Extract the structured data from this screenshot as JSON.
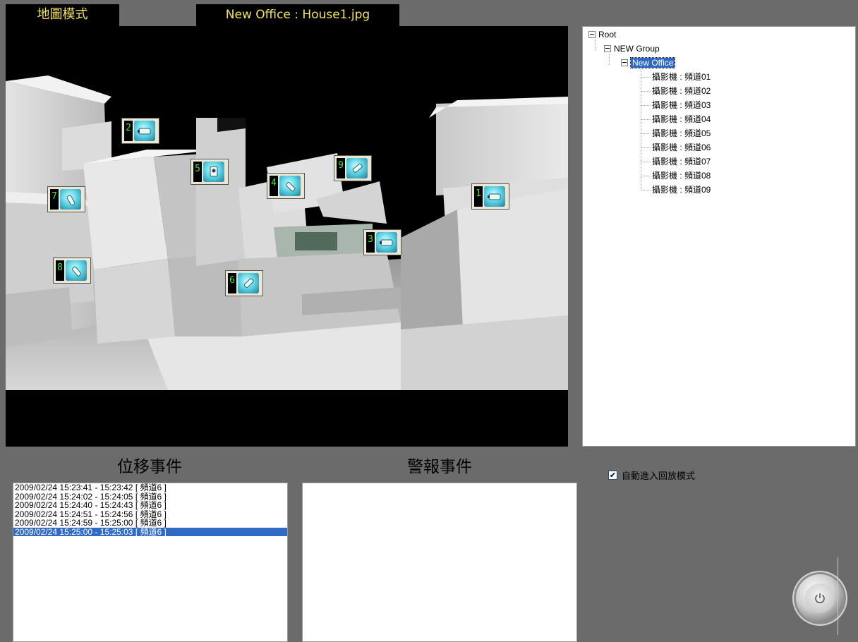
{
  "header": {
    "mode_tab": "地圖模式",
    "file_title": "New Office : House1.jpg"
  },
  "map": {
    "cameras": [
      {
        "num": "1",
        "icon": "dome-camera-icon"
      },
      {
        "num": "2",
        "icon": "dome-camera-icon"
      },
      {
        "num": "3",
        "icon": "dome-camera-icon"
      },
      {
        "num": "4",
        "icon": "bullet-camera-icon"
      },
      {
        "num": "5",
        "icon": "camera-front-icon"
      },
      {
        "num": "6",
        "icon": "bullet-camera-icon"
      },
      {
        "num": "7",
        "icon": "bullet-camera-icon"
      },
      {
        "num": "8",
        "icon": "bullet-camera-icon"
      },
      {
        "num": "9",
        "icon": "bullet-camera-icon"
      }
    ]
  },
  "tree": {
    "root": "Root",
    "group": "NEW Group",
    "office": "New Office",
    "channels": [
      "攝影機 : 頻道01",
      "攝影機 : 頻道02",
      "攝影機 : 頻道03",
      "攝影機 : 頻道04",
      "攝影機 : 頻道05",
      "攝影機 : 頻道06",
      "攝影機 : 頻道07",
      "攝影機 : 頻道08",
      "攝影機 : 頻道09"
    ]
  },
  "motion": {
    "title": "位移事件",
    "events": [
      "2009/02/24  15:23:41 - 15:23:42 [ 頻道6 ]",
      "2009/02/24  15:24:02 - 15:24:05 [ 頻道6 ]",
      "2009/02/24  15:24:40 - 15:24:43 [ 頻道6 ]",
      "2009/02/24  15:24:51 - 15:24:56 [ 頻道6 ]",
      "2009/02/24  15:24:59 - 15:25:00 [ 頻道6 ]",
      "2009/02/24  15:25:00 - 15:25:03 [ 頻道6 ]"
    ],
    "selected_index": 5
  },
  "alarm": {
    "title": "警報事件",
    "events": []
  },
  "options": {
    "auto_playback_label": "自動進入回放模式",
    "auto_playback_checked": true
  },
  "colors": {
    "background": "#6b6b6b",
    "title_text": "#f3e45a",
    "camera_number": "#4be13a",
    "selection": "#316ac5"
  }
}
